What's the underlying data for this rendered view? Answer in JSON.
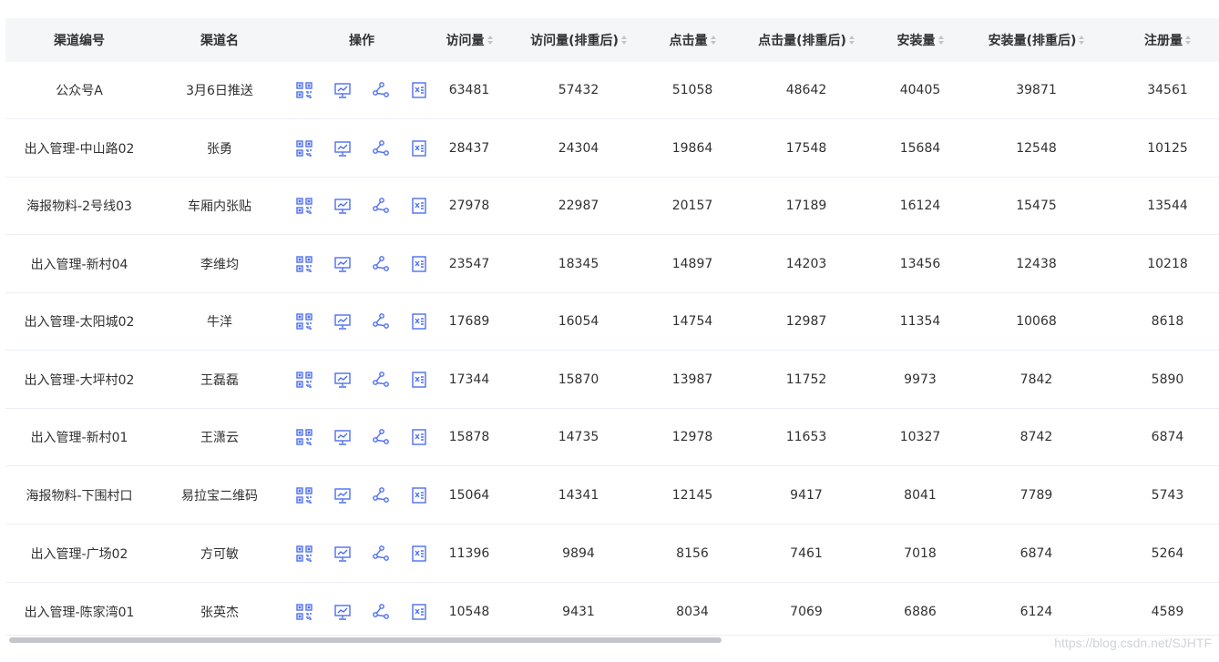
{
  "table": {
    "headers": {
      "channel_id": "渠道编号",
      "channel_name": "渠道名",
      "actions": "操作",
      "visits": "访问量",
      "visits_dedup": "访问量(排重后)",
      "clicks": "点击量",
      "clicks_dedup": "点击量(排重后)",
      "installs": "安装量",
      "installs_dedup": "安装量(排重后)",
      "registrations": "注册量"
    },
    "rows": [
      {
        "channel_id": "公众号A",
        "channel_name": "3月6日推送",
        "visits": "63481",
        "visits_dedup": "57432",
        "clicks": "51058",
        "clicks_dedup": "48642",
        "installs": "40405",
        "installs_dedup": "39871",
        "registrations": "34561"
      },
      {
        "channel_id": "出入管理-中山路02",
        "channel_name": "张勇",
        "visits": "28437",
        "visits_dedup": "24304",
        "clicks": "19864",
        "clicks_dedup": "17548",
        "installs": "15684",
        "installs_dedup": "12548",
        "registrations": "10125"
      },
      {
        "channel_id": "海报物料-2号线03",
        "channel_name": "车厢内张贴",
        "visits": "27978",
        "visits_dedup": "22987",
        "clicks": "20157",
        "clicks_dedup": "17189",
        "installs": "16124",
        "installs_dedup": "15475",
        "registrations": "13544"
      },
      {
        "channel_id": "出入管理-新村04",
        "channel_name": "李维均",
        "visits": "23547",
        "visits_dedup": "18345",
        "clicks": "14897",
        "clicks_dedup": "14203",
        "installs": "13456",
        "installs_dedup": "12438",
        "registrations": "10218"
      },
      {
        "channel_id": "出入管理-太阳城02",
        "channel_name": "牛洋",
        "visits": "17689",
        "visits_dedup": "16054",
        "clicks": "14754",
        "clicks_dedup": "12987",
        "installs": "11354",
        "installs_dedup": "10068",
        "registrations": "8618"
      },
      {
        "channel_id": "出入管理-大坪村02",
        "channel_name": "王磊磊",
        "visits": "17344",
        "visits_dedup": "15870",
        "clicks": "13987",
        "clicks_dedup": "11752",
        "installs": "9973",
        "installs_dedup": "7842",
        "registrations": "5890"
      },
      {
        "channel_id": "出入管理-新村01",
        "channel_name": "王潇云",
        "visits": "15878",
        "visits_dedup": "14735",
        "clicks": "12978",
        "clicks_dedup": "11653",
        "installs": "10327",
        "installs_dedup": "8742",
        "registrations": "6874"
      },
      {
        "channel_id": "海报物料-下围村口",
        "channel_name": "易拉宝二维码",
        "visits": "15064",
        "visits_dedup": "14341",
        "clicks": "12145",
        "clicks_dedup": "9417",
        "installs": "8041",
        "installs_dedup": "7789",
        "registrations": "5743"
      },
      {
        "channel_id": "出入管理-广场02",
        "channel_name": "方可敏",
        "visits": "11396",
        "visits_dedup": "9894",
        "clicks": "8156",
        "clicks_dedup": "7461",
        "installs": "7018",
        "installs_dedup": "6874",
        "registrations": "5264"
      },
      {
        "channel_id": "出入管理-陈家湾01",
        "channel_name": "张英杰",
        "visits": "10548",
        "visits_dedup": "9431",
        "clicks": "8034",
        "clicks_dedup": "7069",
        "installs": "6886",
        "installs_dedup": "6124",
        "registrations": "4589"
      }
    ],
    "row_action_icons": [
      "qrcode-icon",
      "chart-icon",
      "share-icon",
      "excel-export-icon"
    ]
  },
  "watermark": "https://blog.csdn.net/SJHTF",
  "colors": {
    "accent": "#4e6ef2",
    "header_bg": "#f5f6f8",
    "border": "#ebeef5"
  }
}
